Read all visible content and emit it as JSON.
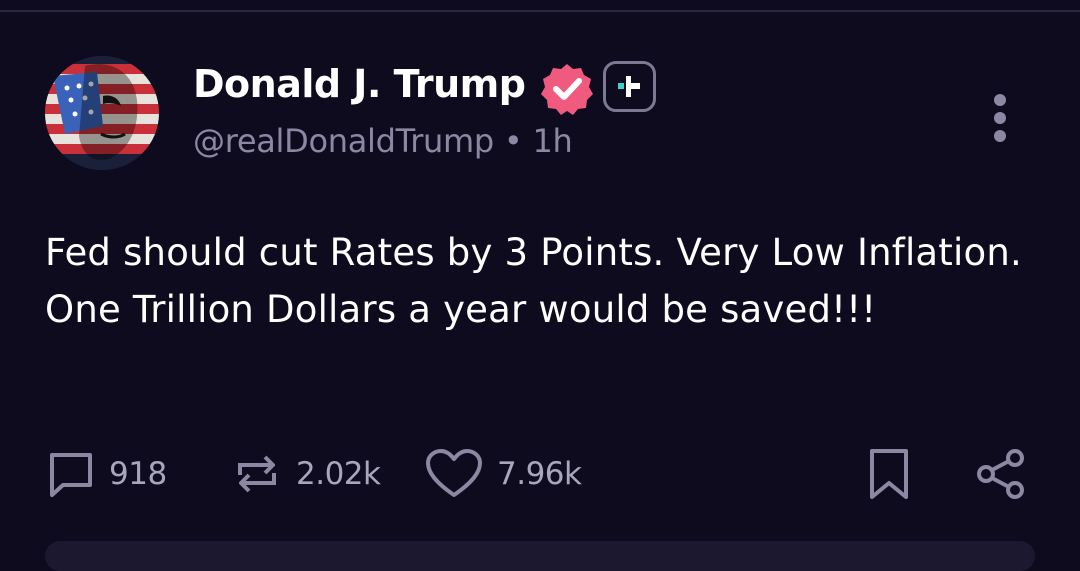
{
  "post": {
    "author": {
      "name": "Donald J. Trump",
      "handle": "@realDonaldTrump",
      "time": "1h",
      "verified_icon": "verified-check-icon",
      "plus_icon": "plus-badge-icon",
      "verified_color": "#f05a7e"
    },
    "text": "Fed should cut Rates by 3 Points. Very Low Inflation. One Trillion Dollars a year would be saved!!!",
    "actions": {
      "replies": "918",
      "reposts": "2.02k",
      "likes": "7.96k"
    }
  },
  "colors": {
    "background": "#0e0b1f",
    "muted_text": "#8c88a3",
    "accent_teal": "#3fd0c9"
  }
}
